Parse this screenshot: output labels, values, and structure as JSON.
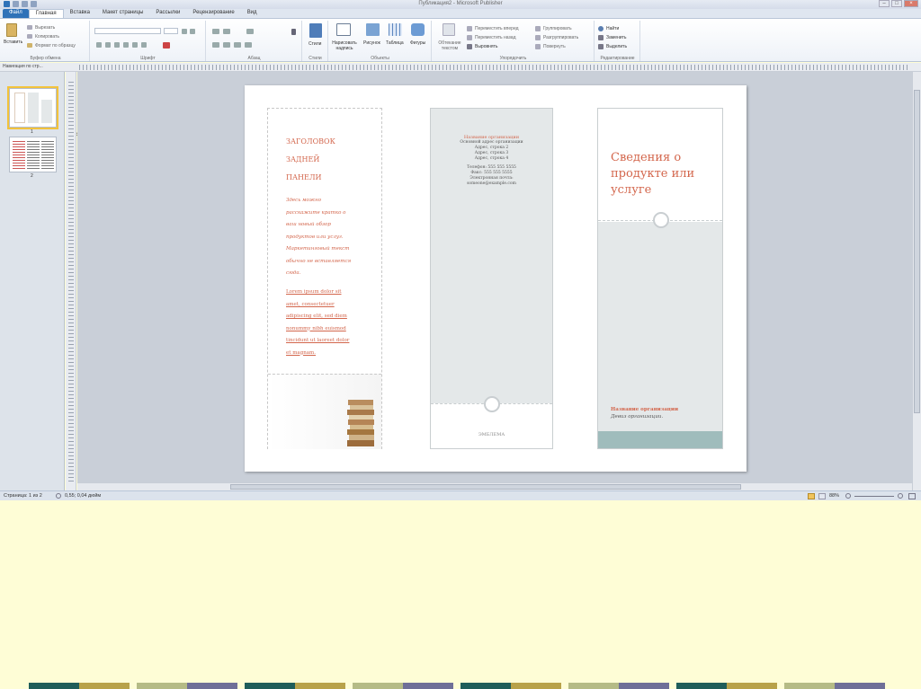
{
  "window": {
    "title": "Публикация2 - Microsoft Publisher"
  },
  "tabs": [
    {
      "label": "Файл"
    },
    {
      "label": "Главная"
    },
    {
      "label": "Вставка"
    },
    {
      "label": "Макет страницы"
    },
    {
      "label": "Рассылки"
    },
    {
      "label": "Рецензирование"
    },
    {
      "label": "Вид"
    }
  ],
  "ribbon": {
    "clipboard": {
      "paste": "Вставить",
      "cut": "Вырезать",
      "copy": "Копировать",
      "format_painter": "Формат по образцу",
      "group": "Буфер обмена"
    },
    "font": {
      "group": "Шрифт"
    },
    "paragraph": {
      "group": "Абзац"
    },
    "styles": {
      "label": "Стили",
      "group": "Стили"
    },
    "objects": {
      "textbox": "Нарисовать надпись",
      "picture": "Рисунок",
      "table": "Таблица",
      "shapes": "Фигуры",
      "group": "Объекты"
    },
    "arrange": {
      "wrap": "Обтекание текстом",
      "bring_forward": "Переместить вперед",
      "send_backward": "Переместить назад",
      "align": "Выровнять",
      "group_btn": "Группировать",
      "ungroup": "Разгруппировать",
      "rotate": "Повернуть",
      "group": "Упорядочить"
    },
    "editing": {
      "find": "Найти",
      "replace": "Заменить",
      "select": "Выделить",
      "group": "Редактирование"
    }
  },
  "nav_pane": {
    "title": "Навигация по стр...",
    "pages": [
      {
        "num": "1"
      },
      {
        "num": "2"
      }
    ]
  },
  "brochure": {
    "panel1": {
      "heading_lines": [
        "ЗАГОЛОВОК",
        "ЗАДНЕЙ",
        "ПАНЕЛИ"
      ],
      "body_lines": [
        "Здесь можно",
        "расскажите кратко о",
        "ваш новый обзор",
        "продуктов или услуг.",
        "Маркетинговый текст",
        "обычно не вставляется",
        "сюда."
      ],
      "lorem_lines": [
        "Lorem ipsum dolor sit",
        "amet, consectetuer",
        "adipiscing elit, sed diem",
        "nonummy nibh euismod",
        "tincidunt ut laoreet dolor",
        "et magnam."
      ]
    },
    "panel2": {
      "org_name": "Название организации",
      "address_lines": [
        "Основной адрес организации",
        "Адрес, строка 2",
        "Адрес, строка 3",
        "Адрес, строка 4"
      ],
      "contact_lines": [
        "Телефон: 555 555 5555",
        "Факс: 555 555 5555",
        "Электронная почта:",
        "someone@example.com"
      ],
      "emblem": "ЭМБЛЕМА"
    },
    "panel3": {
      "title_lines": [
        "Сведения о",
        "продукте или",
        "услуге"
      ],
      "org_name": "Название организации",
      "slogan": "Девиз организации."
    }
  },
  "status": {
    "page": "Страница: 1 из 2",
    "position": "0,55; 0,04 дюйм",
    "zoom": "88%"
  },
  "colors": {
    "accent_red": "#d3664c",
    "panel_gray": "#e4e8e9",
    "teal": "#9fbcbc",
    "file_tab": "#2f72b8"
  },
  "bottom_strip": [
    {
      "left": "#1f5d5a",
      "right": "#b8a24a"
    },
    {
      "left": "#b5bb86",
      "right": "#6f6f98"
    },
    {
      "left": "#1f5d5a",
      "right": "#b8a24a"
    },
    {
      "left": "#b5bb86",
      "right": "#6f6f98"
    },
    {
      "left": "#1f5d5a",
      "right": "#b8a24a"
    },
    {
      "left": "#b5bb86",
      "right": "#6f6f98"
    },
    {
      "left": "#1f5d5a",
      "right": "#b8a24a"
    },
    {
      "left": "#b5bb86",
      "right": "#6f6f98"
    }
  ]
}
